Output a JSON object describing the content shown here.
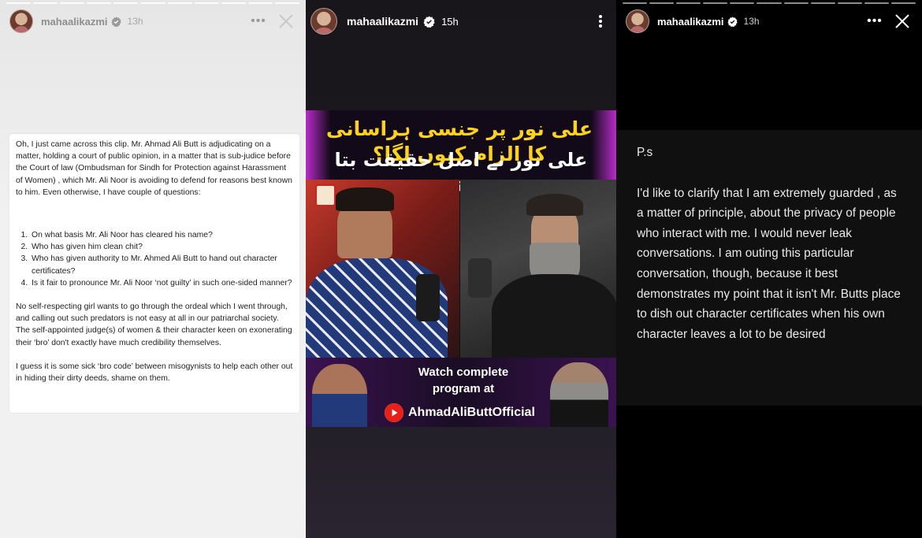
{
  "story_left": {
    "username": "mahaalikazmi",
    "time": "13h",
    "note": {
      "intro": "Oh, I just came across this clip. Mr. Ahmad Ali Butt is adjudicating on a matter, holding a court of public opinion, in a matter that is sub-judice before the Court of law (Ombudsman for Sindh for Protection against Harassment of Women) , which Mr. Ali Noor is avoiding to defend for reasons best known to him. Even otherwise, I have couple of questions:",
      "questions": [
        "On what basis Mr. Ali Noor has cleared his name?",
        "Who has given him clean chit?",
        "Who has given authority to Mr. Ahmed Ali Butt to hand out character certificates?",
        "Is it fair to pronounce Mr. Ali Noor ‘not guilty’ in such one-sided manner?"
      ],
      "para2": "No self-respecting girl wants to go through the ordeal which I went through, and calling out such predators is not easy at all in our patriarchal society. The self-appointed judge(s) of women & their character  keen on exonerating their ‘bro’ don't exactly have much credibility themselves.",
      "para3": "I guess it is some sick ‘bro code’ between misogynists to help each other out in hiding their dirty deeds, shame on them."
    }
  },
  "story_middle": {
    "username": "mahaalikazmi",
    "time": "15h",
    "thumbnail": {
      "urdu_line1": "علی نور پر جنسی ہراسانی کا الزام کیوں لگا؟",
      "urdu_line2": "علی نور نے اصل حقیقت بتا دی",
      "watch_line1": "Watch complete",
      "watch_line2": "program at",
      "channel": "AhmadAliButtOfficial"
    }
  },
  "story_right": {
    "username": "mahaalikazmi",
    "time": "13h",
    "text": {
      "ps": "P.s",
      "body": "I'd like to clarify that I am extremely guarded , as a matter of principle, about the privacy of people who interact with me. I would never leak conversations. I am outing this particular conversation, though, because it best demonstrates my point that it isn't Mr. Butts place to dish out character certificates when his own character leaves a lot to be desired"
    }
  },
  "colors": {
    "urdu_highlight": "#ffd21e",
    "thumbnail_accent": "#b92cc9",
    "youtube_red": "#e62117"
  },
  "icons": [
    "verified-badge-icon",
    "more-options-icon",
    "close-icon",
    "vertical-more-icon",
    "youtube-play-icon"
  ]
}
